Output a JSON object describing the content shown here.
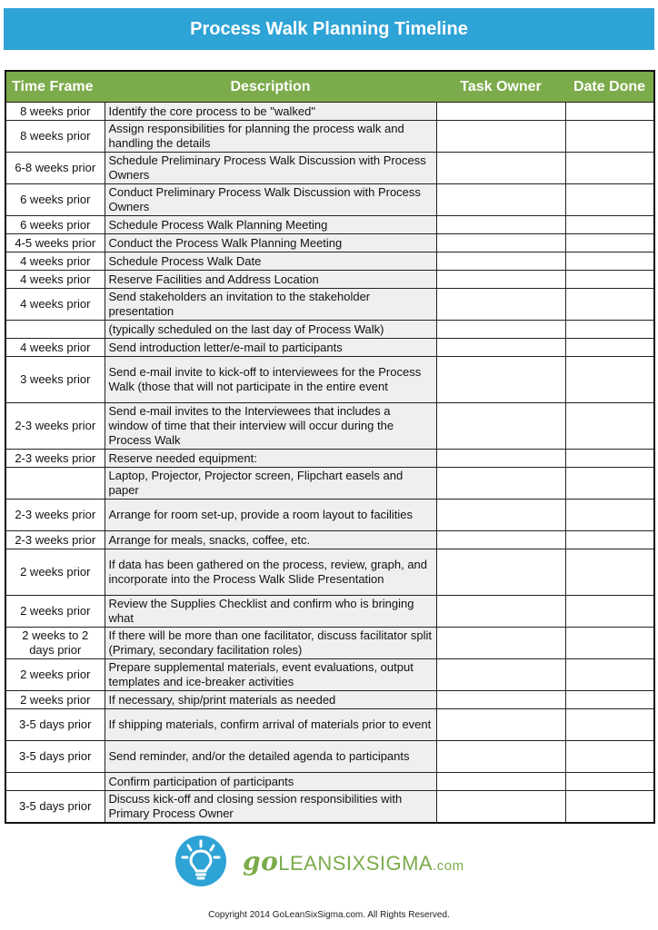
{
  "title": "Process Walk Planning Timeline",
  "table": {
    "headers": {
      "time_frame": "Time Frame",
      "description": "Description",
      "task_owner": "Task Owner",
      "date_done": "Date Done"
    },
    "rows": [
      {
        "time_frame": "8 weeks prior",
        "description": "Identify the core process to be \"walked\"",
        "task_owner": "",
        "date_done": "",
        "lines": 1
      },
      {
        "time_frame": "8 weeks prior",
        "description": "Assign responsibilities for planning the process walk and handling the details",
        "task_owner": "",
        "date_done": "",
        "lines": 2
      },
      {
        "time_frame": "6-8 weeks prior",
        "description": "Schedule Preliminary Process Walk Discussion with Process Owners",
        "task_owner": "",
        "date_done": "",
        "lines": 2
      },
      {
        "time_frame": "6 weeks prior",
        "description": "Conduct Preliminary Process Walk Discussion with Process Owners",
        "task_owner": "",
        "date_done": "",
        "lines": 2
      },
      {
        "time_frame": "6 weeks prior",
        "description": "Schedule Process Walk Planning Meeting",
        "task_owner": "",
        "date_done": "",
        "lines": 1
      },
      {
        "time_frame": "4-5 weeks prior",
        "description": "Conduct the Process Walk Planning Meeting",
        "task_owner": "",
        "date_done": "",
        "lines": 1
      },
      {
        "time_frame": "4 weeks prior",
        "description": "Schedule Process Walk Date",
        "task_owner": "",
        "date_done": "",
        "lines": 1
      },
      {
        "time_frame": "4 weeks prior",
        "description": "Reserve Facilities and Address Location",
        "task_owner": "",
        "date_done": "",
        "lines": 1
      },
      {
        "time_frame": "4 weeks prior",
        "description": "Send stakeholders an invitation to the stakeholder presentation",
        "task_owner": "",
        "date_done": "",
        "lines": 2
      },
      {
        "time_frame": "",
        "description": "(typically scheduled on the last day of Process Walk)",
        "task_owner": "",
        "date_done": "",
        "lines": 1
      },
      {
        "time_frame": "4 weeks prior",
        "description": "Send introduction letter/e-mail to participants",
        "task_owner": "",
        "date_done": "",
        "lines": 1
      },
      {
        "time_frame": "3 weeks prior",
        "description": "Send e-mail invite to kick-off  to interviewees for the Process Walk (those that will not participate in the entire event",
        "task_owner": "",
        "date_done": "",
        "lines": 3
      },
      {
        "time_frame": "2-3 weeks prior",
        "description": "Send e-mail invites to the Interviewees that includes a window of time that their interview will occur during the Process Walk",
        "task_owner": "",
        "date_done": "",
        "lines": 3
      },
      {
        "time_frame": "2-3 weeks prior",
        "description": "Reserve needed equipment:",
        "task_owner": "",
        "date_done": "",
        "lines": 1
      },
      {
        "time_frame": "",
        "description": "Laptop, Projector, Projector screen, Flipchart easels and paper",
        "task_owner": "",
        "date_done": "",
        "lines": 2
      },
      {
        "time_frame": "2-3 weeks prior",
        "description": "Arrange for room set-up, provide a room layout to facilities",
        "task_owner": "",
        "date_done": "",
        "lines": 2
      },
      {
        "time_frame": "2-3 weeks prior",
        "description": "Arrange for meals, snacks, coffee, etc.",
        "task_owner": "",
        "date_done": "",
        "lines": 1
      },
      {
        "time_frame": "2 weeks prior",
        "description": "If data has been gathered on the process, review, graph, and incorporate into the Process Walk Slide Presentation",
        "task_owner": "",
        "date_done": "",
        "lines": 3
      },
      {
        "time_frame": "2 weeks prior",
        "description": "Review the Supplies Checklist and confirm who is bringing what",
        "task_owner": "",
        "date_done": "",
        "lines": 2
      },
      {
        "time_frame": "2 weeks to 2 days prior",
        "description": "If there will be more than one facilitator, discuss facilitator split (Primary, secondary facilitation roles)",
        "task_owner": "",
        "date_done": "",
        "lines": 2
      },
      {
        "time_frame": "2 weeks prior",
        "description": "Prepare supplemental materials, event evaluations, output templates and ice-breaker activities",
        "task_owner": "",
        "date_done": "",
        "lines": 2
      },
      {
        "time_frame": "2 weeks prior",
        "description": "If necessary, ship/print materials as needed",
        "task_owner": "",
        "date_done": "",
        "lines": 1
      },
      {
        "time_frame": "3-5 days prior",
        "description": "If shipping materials, confirm arrival of materials prior to event",
        "task_owner": "",
        "date_done": "",
        "lines": 2
      },
      {
        "time_frame": "3-5 days prior",
        "description": "Send reminder, and/or the detailed agenda to participants",
        "task_owner": "",
        "date_done": "",
        "lines": 2
      },
      {
        "time_frame": "",
        "description": "Confirm participation of participants",
        "task_owner": "",
        "date_done": "",
        "lines": 1
      },
      {
        "time_frame": "3-5 days prior",
        "description": "Discuss kick-off and closing session responsibilities with Primary Process Owner",
        "task_owner": "",
        "date_done": "",
        "lines": 2
      }
    ]
  },
  "logo": {
    "icon": "lightbulb-icon",
    "go": "go",
    "name": "LEANSIXSIGMA",
    "suffix": ".com",
    "brand_green": "#7bab4a",
    "brand_blue": "#2ea3d6"
  },
  "footer": {
    "copyright": "Copyright 2014 GoLeanSixSigma.com. All Rights Reserved."
  }
}
